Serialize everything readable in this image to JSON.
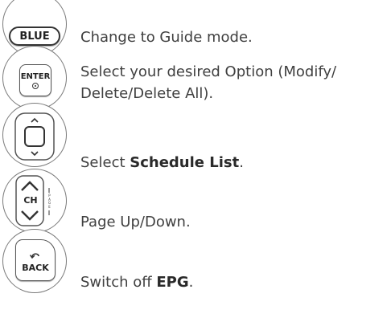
{
  "steps": [
    {
      "button": "BLUE",
      "text": "Change to Guide mode."
    },
    {
      "button": "ENTER",
      "line1": "Select your desired Option (Modify/",
      "line2": "Delete/Delete All)."
    },
    {
      "button_icon": "nav-pad-icon",
      "pre": "Select ",
      "bold": "Schedule List",
      "post": "."
    },
    {
      "button": "CH",
      "side_label": "P A G E",
      "text": "Page Up/Down."
    },
    {
      "button": "BACK",
      "pre": "Switch off ",
      "bold": "EPG",
      "post": "."
    }
  ],
  "colors": {
    "text": "#404040",
    "border": "#7a7a7a",
    "icon": "#333333"
  }
}
